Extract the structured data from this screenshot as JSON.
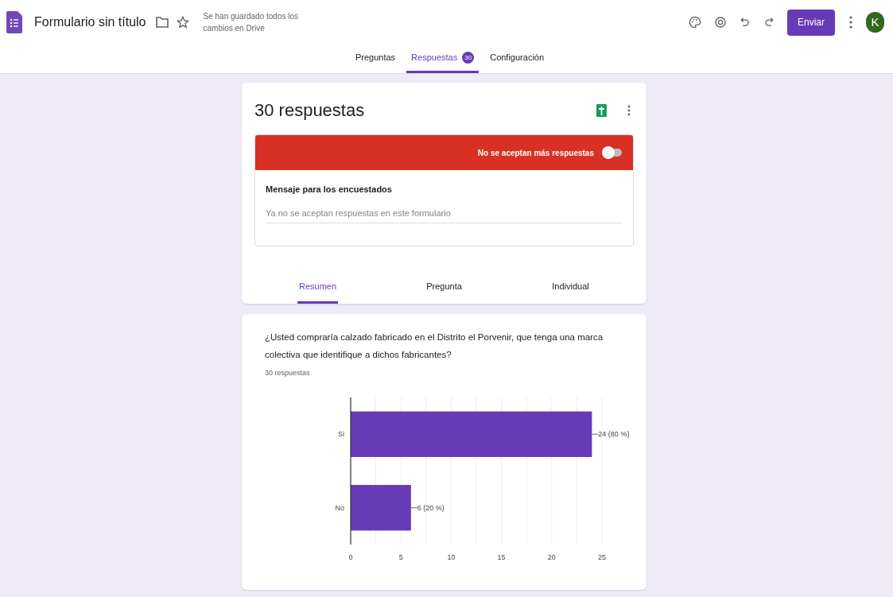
{
  "header": {
    "title": "Formulario sin título",
    "save_status": "Se han guardado todos los cambios en Drive",
    "send_button": "Enviar",
    "avatar": "K"
  },
  "tabs": [
    {
      "label": "Preguntas",
      "selected": false
    },
    {
      "label": "Respuestas",
      "badge": "30",
      "selected": true
    },
    {
      "label": "Configuración",
      "selected": false
    }
  ],
  "responses_card": {
    "title": "30 respuestas",
    "accepting_label": "No se aceptan más respuestas",
    "accepting": false,
    "message_label": "Mensaje para los encuestados",
    "message_placeholder": "Ya no se aceptan respuestas en este formulario",
    "view_tabs": [
      {
        "label": "Resumen",
        "selected": true
      },
      {
        "label": "Pregunta",
        "selected": false
      },
      {
        "label": "Individual",
        "selected": false
      }
    ]
  },
  "question_card": {
    "question": "¿Usted compraría calzado fabricado en el Distrito el Porvenir, que tenga una marca colectiva que identifique a dichos fabricantes?",
    "count": "30 respuestas",
    "chart_data": {
      "type": "bar",
      "orientation": "horizontal",
      "categories": [
        "Si",
        "No"
      ],
      "series": [
        {
          "color": "#673ab7",
          "values": [
            24,
            6
          ]
        }
      ],
      "grid": true,
      "value_labels": [
        "24 (80 %)",
        "6 (20 %)"
      ],
      "xlim": [
        0,
        25
      ],
      "xticks": [
        0,
        5,
        10,
        15,
        20,
        25
      ]
    }
  }
}
